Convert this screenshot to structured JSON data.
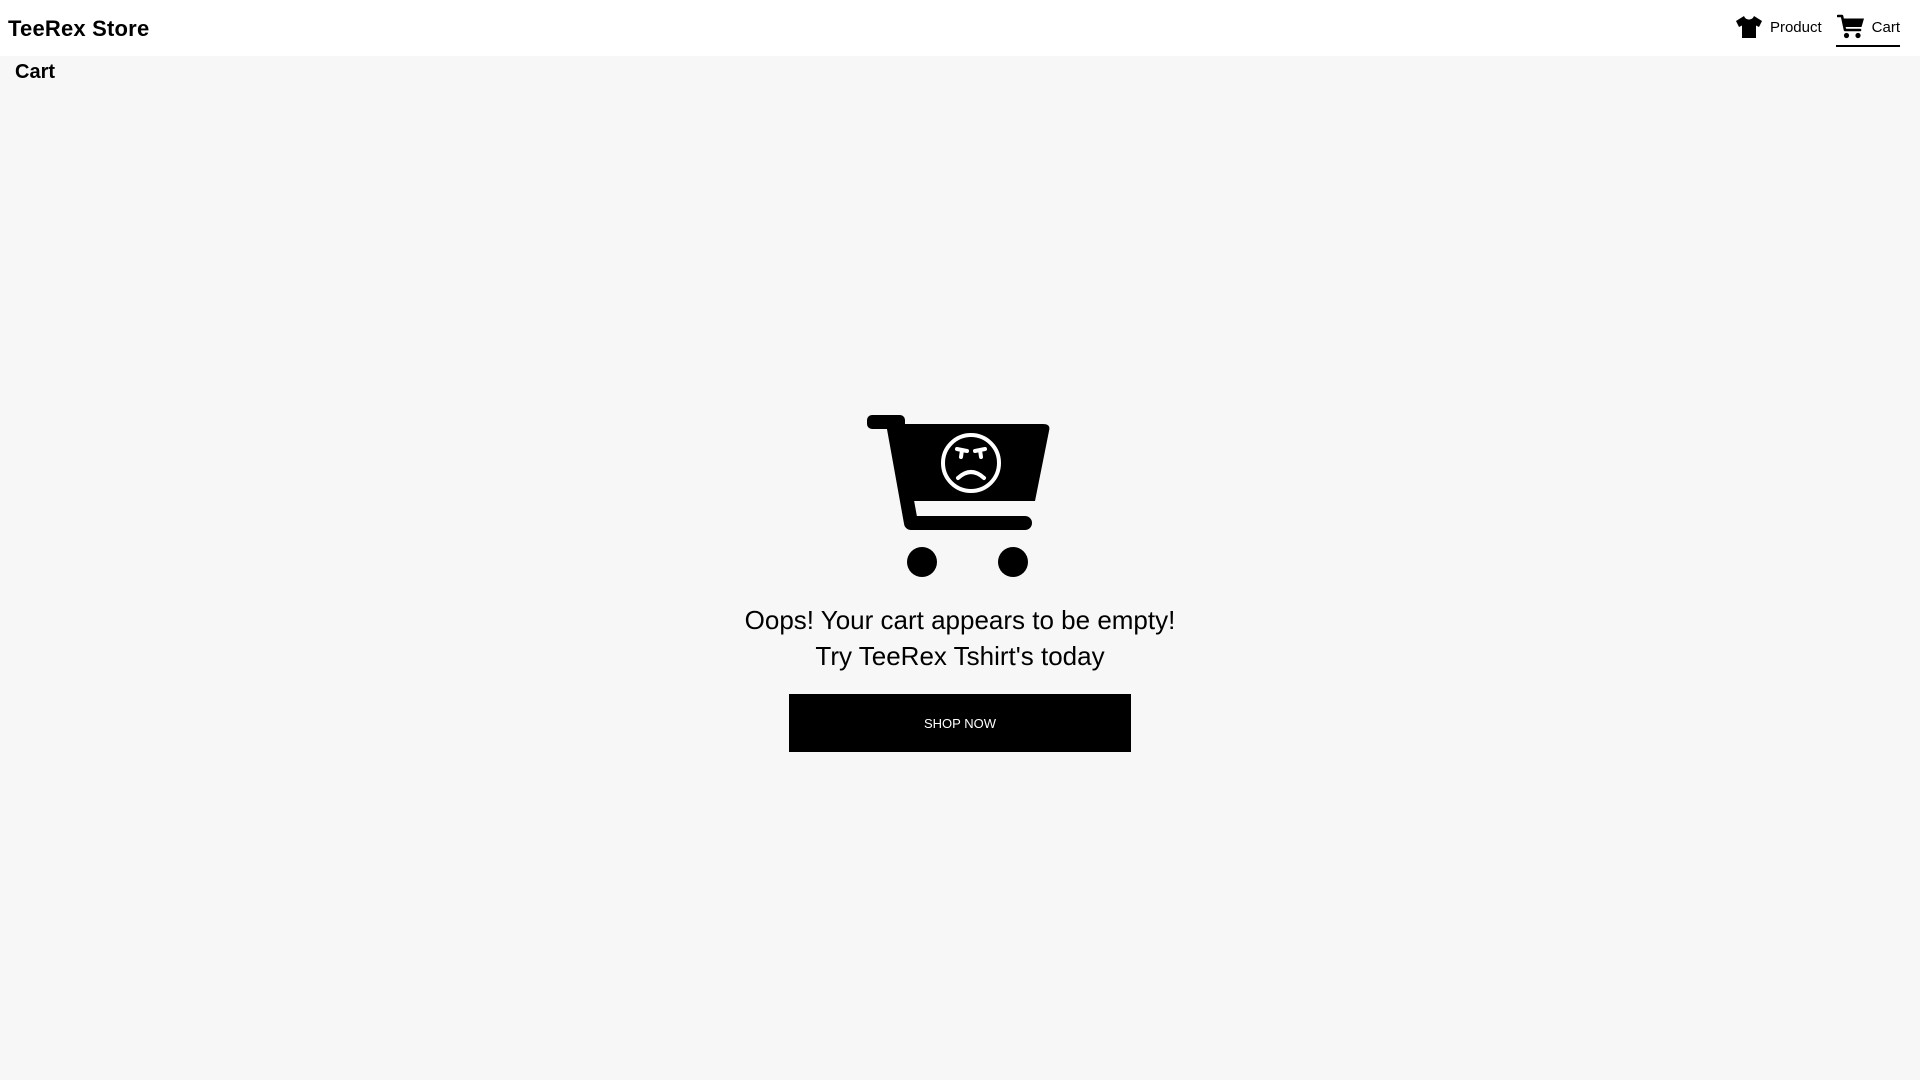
{
  "header": {
    "brand": "TeeRex Store",
    "nav": [
      {
        "label": "Product",
        "icon": "tshirt-icon",
        "active": false
      },
      {
        "label": "Cart",
        "icon": "cart-icon",
        "active": true
      }
    ]
  },
  "page": {
    "title": "Cart"
  },
  "empty_state": {
    "illustration": "sad-cart-icon",
    "message_line1": "Oops! Your cart appears to be empty!",
    "message_line2": "Try TeeRex Tshirt's today",
    "button_label": "SHOP NOW"
  },
  "colors": {
    "background": "#f7f7f7",
    "navbar": "#ffffff",
    "button": "#000000",
    "button_text": "#ffffff"
  }
}
